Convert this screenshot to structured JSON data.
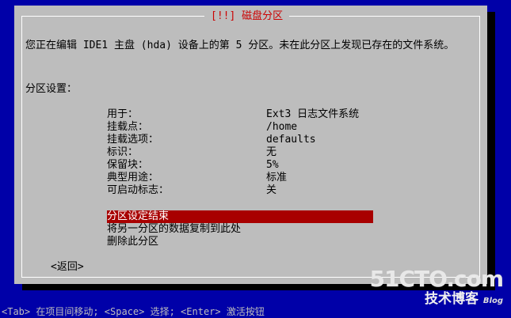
{
  "dialog": {
    "title": "[!!] 磁盘分区",
    "description": "您正在编辑 IDE1 主盘 (hda) 设备上的第 5 分区。未在此分区上发现已存在的文件系统。",
    "section_label": "分区设置："
  },
  "settings": [
    {
      "label": "用于：",
      "value": "Ext3 日志文件系统"
    },
    {
      "label": "挂载点：",
      "value": "/home"
    },
    {
      "label": "挂载选项：",
      "value": "defaults"
    },
    {
      "label": "标识：",
      "value": "无"
    },
    {
      "label": "保留块：",
      "value": "5%"
    },
    {
      "label": "典型用途：",
      "value": "标准"
    },
    {
      "label": "可启动标志：",
      "value": "关"
    }
  ],
  "actions": [
    {
      "label": "分区设定结束",
      "selected": true
    },
    {
      "label": "将另一分区的数据复制到此处",
      "selected": false
    },
    {
      "label": "删除此分区",
      "selected": false
    }
  ],
  "back_button": "<返回>",
  "statusbar": "<Tab> 在项目间移动; <Space> 选择; <Enter> 激活按钮",
  "watermark": {
    "logo": "51CTO.com",
    "subtitle": "技术博客",
    "blog": "Blog"
  },
  "colors": {
    "background": "#0000a8",
    "dialog": "#bdbdbd",
    "title": "#cc0000",
    "selection": "#a80000"
  }
}
